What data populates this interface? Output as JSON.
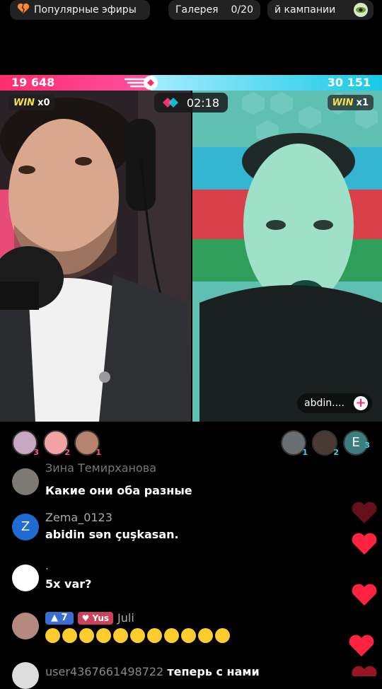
{
  "topbar": {
    "popular_label": "Популярные эфиры",
    "gallery_label": "Галерея",
    "gallery_count": "0/20",
    "campaign_label": "й кампании"
  },
  "battle": {
    "left_score": "19 648",
    "right_score": "30 151",
    "timer": "02:18",
    "left_win_label": "WIN",
    "left_win_count": "x0",
    "right_win_label": "WIN",
    "right_win_count": "x1",
    "opponent_name": "abdin....",
    "left_share": 0.395
  },
  "supporters": {
    "left_ranks": [
      "3",
      "2",
      "1"
    ],
    "right_ranks": [
      "1",
      "2",
      "3"
    ],
    "right_third_initial": "E"
  },
  "chat": {
    "messages": [
      {
        "user": "Зина Темирханова",
        "text": "Какие они оба разные"
      },
      {
        "user": "Zema_0123",
        "initial": "Z",
        "text": "abidin sən çuşkasan."
      },
      {
        "user": ".",
        "text": "5x var?"
      },
      {
        "user": "Juli",
        "level": "7",
        "fan_badge": "Yus",
        "text": ""
      },
      {
        "user": "user4367661498722",
        "text": "теперь с нами"
      }
    ]
  },
  "colors": {
    "left_team": "#ff2d6e",
    "right_team": "#18c9e6",
    "heart": "#ff2340"
  }
}
